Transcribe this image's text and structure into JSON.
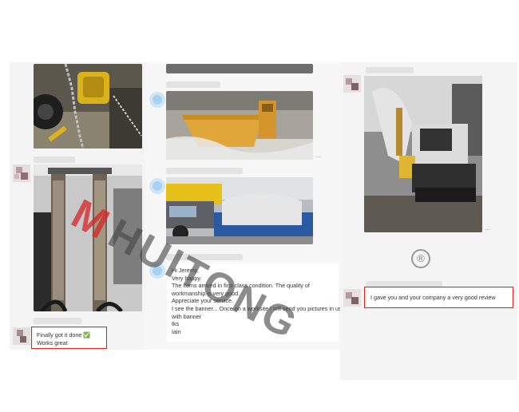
{
  "watermark": {
    "brand": "HUITONG",
    "logo_mark": "M",
    "registered": "®"
  },
  "chat_left": {
    "message": {
      "line1": "Finally got it done ✅",
      "line2": "Works great"
    }
  },
  "chat_middle": {
    "message_lines": [
      "Hi Jeremy,",
      "Very happy.",
      "The items arrived in first class condition. The quality of",
      "workmanship is very good.",
      "Appreciate your service.",
      "I see the banner... Once on a worksite I will send you pictures in use",
      "with banner",
      "tks",
      "Iain"
    ]
  },
  "chat_right": {
    "message": "I gave you and your company a very good review"
  },
  "more_indicator": "...",
  "colors": {
    "highlight_red": "#e2231a",
    "bucket_yellow": "#e0a63a",
    "panel_bg": "#f4f4f4"
  }
}
